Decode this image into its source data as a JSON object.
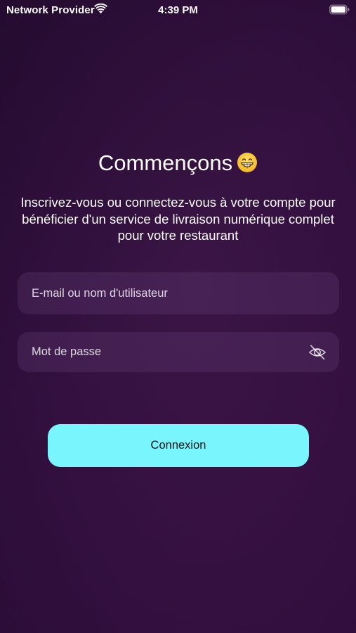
{
  "status_bar": {
    "carrier": "Network Provider",
    "time": "4:39 PM",
    "wifi_icon": "wifi-icon",
    "battery_icon": "battery-icon"
  },
  "header": {
    "title": "Commençons",
    "emoji_icon": "grinning-face-icon"
  },
  "subtitle": "Inscrivez-vous ou connectez-vous à votre compte pour bénéficier d'un service de livraison numérique complet pour votre restaurant",
  "form": {
    "email": {
      "placeholder": "E-mail ou nom d'utilisateur",
      "value": ""
    },
    "password": {
      "placeholder": "Mot de passe",
      "value": "",
      "toggle_icon": "eye-slash-icon"
    },
    "submit_label": "Connexion"
  },
  "colors": {
    "background": "#33103f",
    "accent": "#79f5fd",
    "field_background": "#462455",
    "text": "#ffffff"
  }
}
